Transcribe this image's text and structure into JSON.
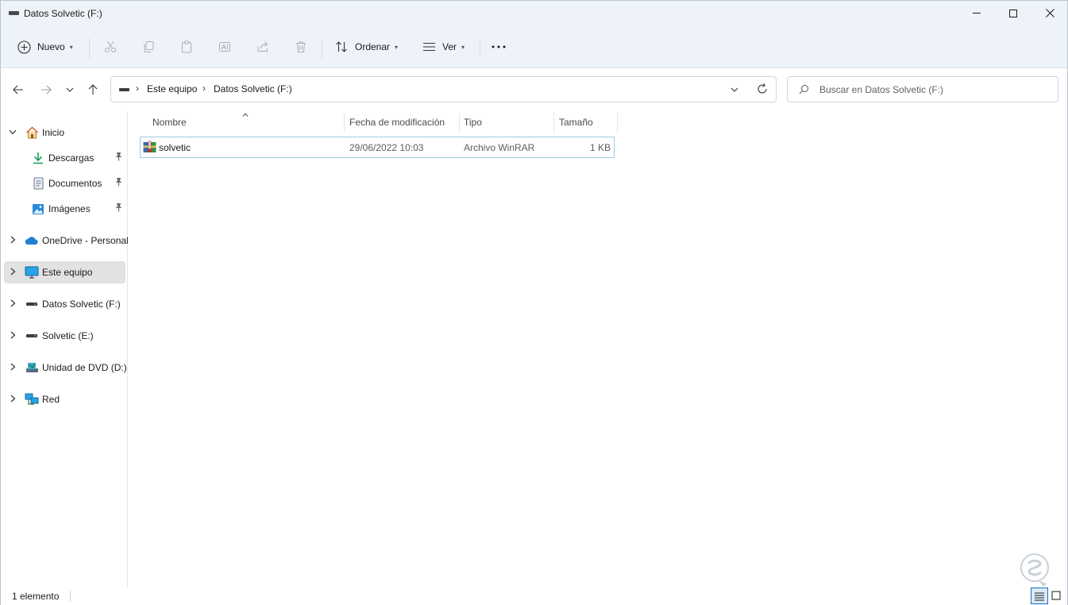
{
  "window": {
    "title": "Datos Solvetic (F:)",
    "drive_icon": "drive-icon"
  },
  "commandbar": {
    "new_label": "Nuevo",
    "sort_label": "Ordenar",
    "view_label": "Ver",
    "more_label": "..."
  },
  "address": {
    "crumbs": [
      "Este equipo",
      "Datos Solvetic (F:)"
    ]
  },
  "search": {
    "placeholder": "Buscar en Datos Solvetic (F:)"
  },
  "sidebar": {
    "items": [
      {
        "label": "Inicio",
        "icon": "home-icon"
      },
      {
        "label": "Descargas",
        "icon": "download-icon"
      },
      {
        "label": "Documentos",
        "icon": "document-icon"
      },
      {
        "label": "Imágenes",
        "icon": "pictures-icon"
      },
      {
        "label": "OneDrive - Personal",
        "icon": "onedrive-icon"
      },
      {
        "label": "Este equipo",
        "icon": "this-pc-icon"
      },
      {
        "label": "Datos Solvetic (F:)",
        "icon": "drive-icon"
      },
      {
        "label": "Solvetic (E:)",
        "icon": "drive-icon"
      },
      {
        "label": "Unidad de DVD (D:)",
        "icon": "dvd-drive-icon"
      },
      {
        "label": "Red",
        "icon": "network-icon"
      }
    ]
  },
  "columns": {
    "name": "Nombre",
    "modified": "Fecha de modificación",
    "type": "Tipo",
    "size": "Tamaño"
  },
  "files": [
    {
      "name": "solvetic",
      "modified": "29/06/2022 10:03",
      "type": "Archivo WinRAR",
      "size": "1 KB",
      "icon": "winrar-archive-icon"
    }
  ],
  "status": {
    "count": "1 elemento"
  },
  "colors": {
    "chrome_bg": "#eef3f9",
    "selection_border": "#9fcbe6",
    "selected_nav_bg": "#e2e2e2"
  }
}
